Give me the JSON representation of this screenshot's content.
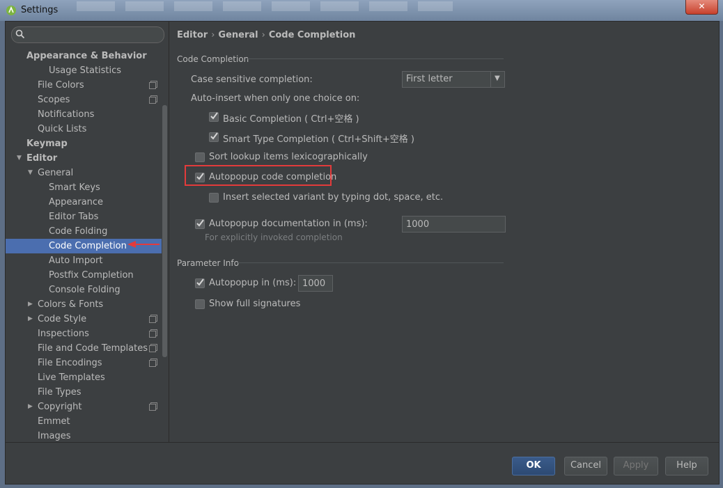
{
  "window": {
    "title": "Settings",
    "close_label": "✕"
  },
  "sidebar": {
    "search": {
      "value": "",
      "placeholder": ""
    },
    "items": [
      {
        "label": "Appearance & Behavior",
        "level": 0,
        "bold": true
      },
      {
        "label": "Usage Statistics",
        "level": 2
      },
      {
        "label": "File Colors",
        "level": 1,
        "project": true
      },
      {
        "label": "Scopes",
        "level": 1,
        "project": true
      },
      {
        "label": "Notifications",
        "level": 1
      },
      {
        "label": "Quick Lists",
        "level": 1
      },
      {
        "label": "Keymap",
        "level": 0,
        "bold": true
      },
      {
        "label": "Editor",
        "level": 0,
        "bold": true,
        "arrow": "down"
      },
      {
        "label": "General",
        "level": 1,
        "arrow": "down"
      },
      {
        "label": "Smart Keys",
        "level": 2
      },
      {
        "label": "Appearance",
        "level": 2
      },
      {
        "label": "Editor Tabs",
        "level": 2
      },
      {
        "label": "Code Folding",
        "level": 2
      },
      {
        "label": "Code Completion",
        "level": 2,
        "selected": true
      },
      {
        "label": "Auto Import",
        "level": 2
      },
      {
        "label": "Postfix Completion",
        "level": 2
      },
      {
        "label": "Console Folding",
        "level": 2
      },
      {
        "label": "Colors & Fonts",
        "level": 1,
        "arrow": "right"
      },
      {
        "label": "Code Style",
        "level": 1,
        "arrow": "right",
        "project": true
      },
      {
        "label": "Inspections",
        "level": 1,
        "project": true
      },
      {
        "label": "File and Code Templates",
        "level": 1,
        "project": true
      },
      {
        "label": "File Encodings",
        "level": 1,
        "project": true
      },
      {
        "label": "Live Templates",
        "level": 1
      },
      {
        "label": "File Types",
        "level": 1
      },
      {
        "label": "Copyright",
        "level": 1,
        "arrow": "right",
        "project": true
      },
      {
        "label": "Emmet",
        "level": 1
      },
      {
        "label": "Images",
        "level": 1
      }
    ]
  },
  "breadcrumb": {
    "part1": "Editor",
    "part2": "General",
    "part3": "Code Completion",
    "sep": "›"
  },
  "code_completion": {
    "section_title": "Code Completion",
    "case_sensitive_label": "Case sensitive completion:",
    "case_sensitive_value": "First letter",
    "auto_insert_label": "Auto-insert when only one choice on:",
    "basic_completion": {
      "label": "Basic Completion ( Ctrl+空格 )",
      "checked": true
    },
    "smart_type_completion": {
      "label": "Smart Type Completion ( Ctrl+Shift+空格 )",
      "checked": true
    },
    "sort_lookup": {
      "label": "Sort lookup items lexicographically",
      "checked": false
    },
    "autopopup_code": {
      "label": "Autopopup code completion",
      "checked": true
    },
    "insert_selected": {
      "label": "Insert selected variant by typing dot, space, etc.",
      "checked": false
    },
    "autopopup_doc": {
      "label": "Autopopup documentation in (ms):",
      "checked": true,
      "value": "1000"
    },
    "hint": "For explicitly invoked completion"
  },
  "parameter_info": {
    "section_title": "Parameter Info",
    "autopopup": {
      "label": "Autopopup in (ms):",
      "checked": true,
      "value": "1000"
    },
    "show_full_signatures": {
      "label": "Show full signatures",
      "checked": false
    }
  },
  "buttons": {
    "ok": "OK",
    "cancel": "Cancel",
    "apply": "Apply",
    "help": "Help"
  },
  "colors": {
    "background": "#3c3f41",
    "selection": "#4b6eaf",
    "highlight_box": "#e33b3b",
    "text": "#bbbbbb"
  }
}
